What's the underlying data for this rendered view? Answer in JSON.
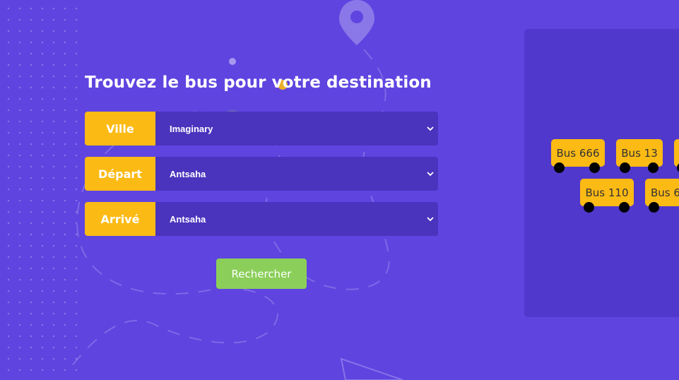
{
  "search": {
    "title": "Trouvez le bus pour votre destination",
    "fields": [
      {
        "label": "Ville",
        "value": "Imaginary"
      },
      {
        "label": "Départ",
        "value": "Antsaha"
      },
      {
        "label": "Arrivé",
        "value": "Antsaha"
      }
    ],
    "submit_label": "Rechercher"
  },
  "buses": [
    {
      "label": "Bus 666"
    },
    {
      "label": "Bus 13"
    },
    {
      "label": "Bus 110"
    },
    {
      "label": "Bus 6"
    }
  ],
  "icons": {
    "location": "map-pin-icon",
    "chevron": "chevron-down-icon",
    "bus": "bus-icon"
  },
  "colors": {
    "background": "#5f44e0",
    "accent": "#fcba14",
    "select_bg": "#4a34bd",
    "button": "#8bcf5a"
  }
}
